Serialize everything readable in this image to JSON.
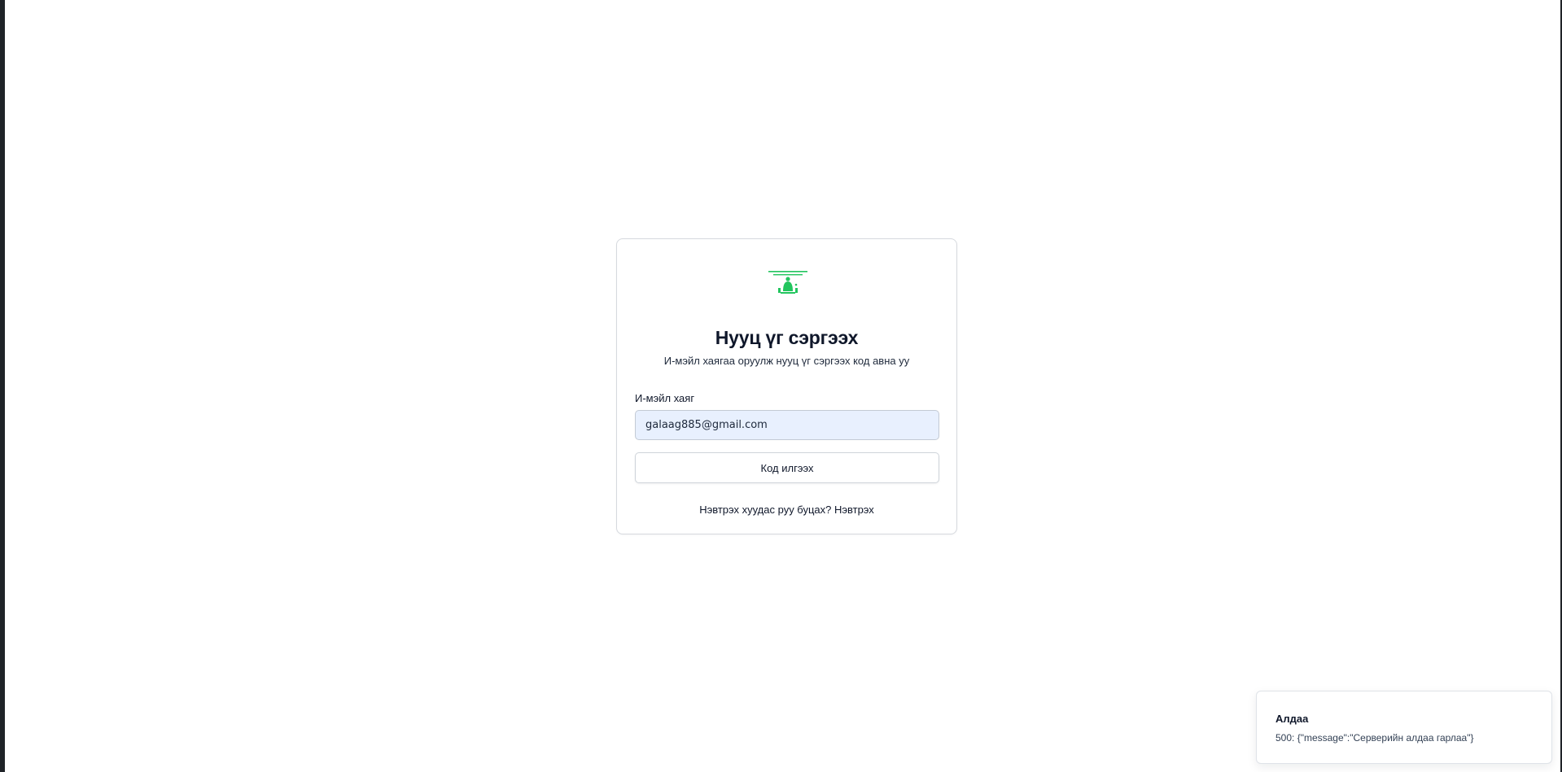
{
  "logo": {
    "name": "organization-logo-icon",
    "color": "#22c55e"
  },
  "form": {
    "title": "Нууц үг сэргээх",
    "subtitle": "И-мэйл хаягаа оруулж нууц үг сэргээх код авна уу",
    "email_label": "И-мэйл хаяг",
    "email_value": "galaag885@gmail.com",
    "submit_label": "Код илгээх",
    "back_text": "Нэвтрэх хуудас руу буцах?",
    "back_link": "Нэвтрэх"
  },
  "toast": {
    "title": "Алдаа",
    "message": "500: {\"message\":\"Серверийн алдаа гарлаа\"}"
  },
  "colors": {
    "input_autofill_bg": "#e8f0fe",
    "accent_green": "#22c55e",
    "text_primary": "#0f172a"
  }
}
